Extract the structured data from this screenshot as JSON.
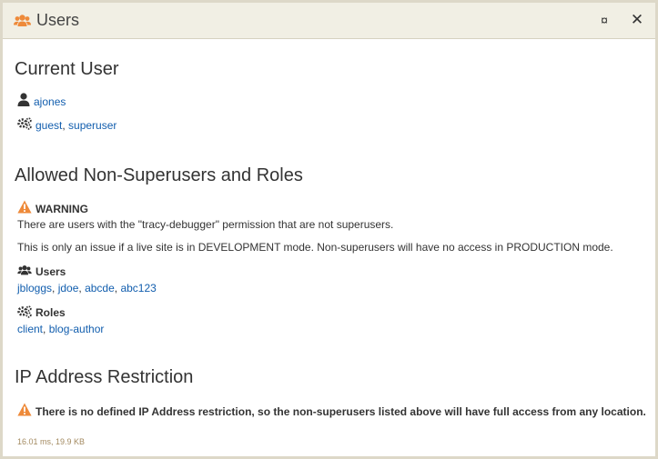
{
  "window": {
    "title": "Users",
    "pin_glyph": "¤",
    "close_glyph": "✕"
  },
  "current_user": {
    "heading": "Current User",
    "username": "ajones",
    "roles": [
      "guest",
      "superuser"
    ]
  },
  "non_superusers": {
    "heading": "Allowed Non-Superusers and Roles",
    "warning_label": "WARNING",
    "warning_text": "There are users with the \"tracy-debugger\" permission that are not superusers.",
    "mode_note": "This is only an issue if a live site is in DEVELOPMENT mode. Non-superusers will have no access in PRODUCTION mode.",
    "users_label": "Users",
    "users": [
      "jbloggs",
      "jdoe",
      "abcde",
      "abc123"
    ],
    "roles_label": "Roles",
    "roles": [
      "client",
      "blog-author"
    ]
  },
  "ip_restriction": {
    "heading": "IP Address Restriction",
    "message": "There is no defined IP Address restriction, so the non-superusers listed above will have full access from any location."
  },
  "footer": "16.01 ms, 19.9 KB",
  "colors": {
    "accent_orange": "#ee8a3a",
    "link_blue": "#125eae",
    "titlebar_bg": "#f1efe4",
    "border": "#ddd8c8"
  },
  "icons": {
    "title": "users-icon",
    "current_user": "user-icon",
    "current_roles": "gears-icon",
    "warning": "warning-icon",
    "users": "users-icon",
    "roles": "gears-icon",
    "ip": "warning-icon"
  }
}
